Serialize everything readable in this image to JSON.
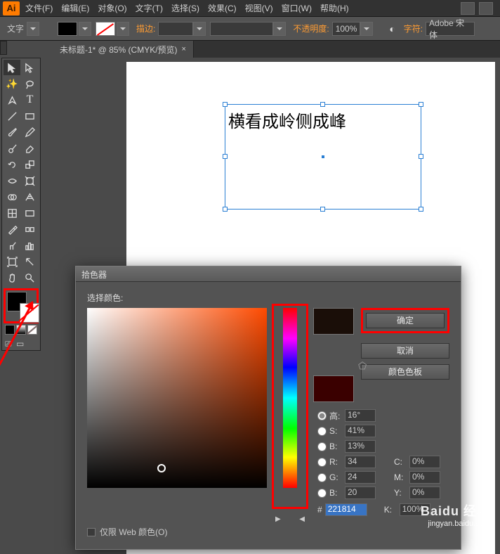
{
  "logo": "Ai",
  "menu": [
    "文件(F)",
    "编辑(E)",
    "对象(O)",
    "文字(T)",
    "选择(S)",
    "效果(C)",
    "视图(V)",
    "窗口(W)",
    "帮助(H)"
  ],
  "optbar": {
    "tool": "文字",
    "stroke_label": "描边:",
    "stroke_val": "",
    "opacity_label": "不透明度:",
    "opacity_val": "100%",
    "char_label": "字符:",
    "font": "Adobe 宋体"
  },
  "doc": {
    "tab": "未标题-1* @ 85% (CMYK/预览)",
    "close": "×",
    "text": "横看成岭侧成峰"
  },
  "picker": {
    "title": "拾色器",
    "select_label": "选择颜色:",
    "ok": "确定",
    "cancel": "取消",
    "swatches": "颜色色板",
    "H": {
      "lab": "高:",
      "val": "16°"
    },
    "S": {
      "lab": "S:",
      "val": "41%"
    },
    "Br": {
      "lab": "B:",
      "val": "13%"
    },
    "R": {
      "lab": "R:",
      "val": "34"
    },
    "G": {
      "lab": "G:",
      "val": "24"
    },
    "Bv": {
      "lab": "B:",
      "val": "20"
    },
    "C": {
      "lab": "C:",
      "val": "0%"
    },
    "M": {
      "lab": "M:",
      "val": "0%"
    },
    "Y": {
      "lab": "Y:",
      "val": "0%"
    },
    "K": {
      "lab": "K:",
      "val": "100%"
    },
    "hex_label": "#",
    "hex": "221814",
    "webonly": "仅限 Web 颜色(O)"
  },
  "watermark": {
    "brand": "Baidu 经验",
    "url": "jingyan.baidu.com"
  }
}
